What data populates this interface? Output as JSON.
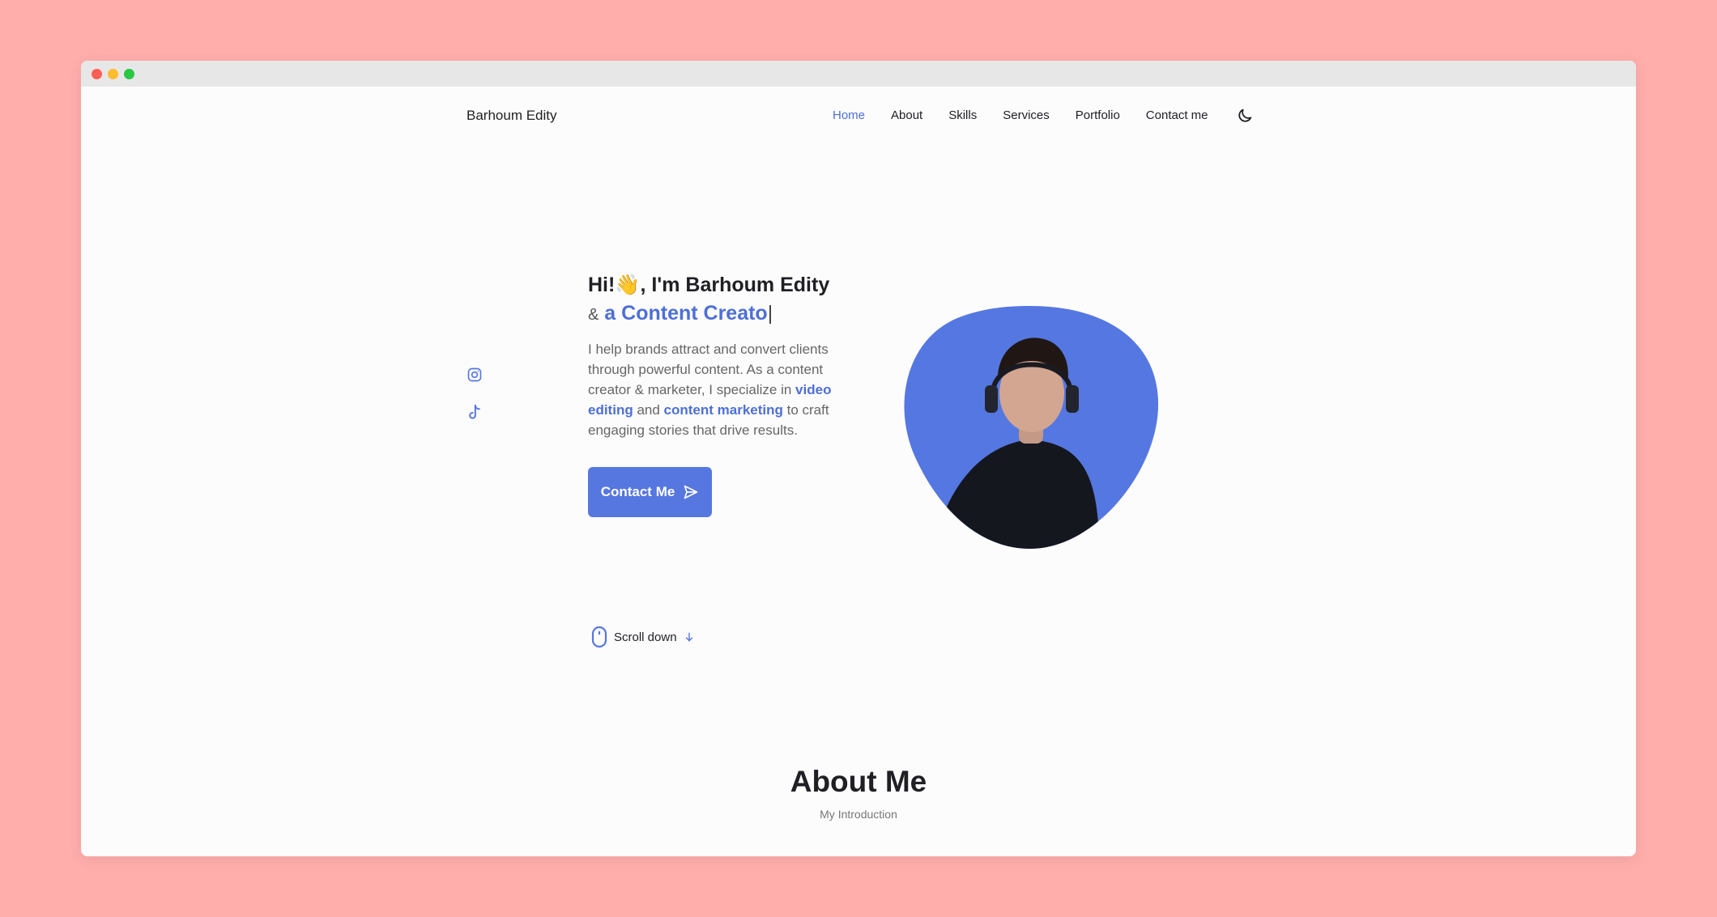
{
  "nav": {
    "logo": "Barhoum Edity",
    "links": [
      "Home",
      "About",
      "Skills",
      "Services",
      "Portfolio",
      "Contact me"
    ],
    "active": "Home",
    "theme_icon": "moon-icon"
  },
  "hero": {
    "greeting": "Hi!",
    "wave_emoji": "👋",
    "name_part": ", I'm Barhoum Edity",
    "amp": "&",
    "role": "a Content Creato",
    "cursor": "|",
    "desc_1": "I help brands attract and convert clients through powerful content. As a content creator & marketer, I specialize in ",
    "desc_hl_1": "video editing",
    "desc_2": " and ",
    "desc_hl_2": "content marketing",
    "desc_3": " to craft engaging stories that drive results.",
    "button_label": "Contact Me"
  },
  "social": [
    "instagram-icon",
    "tiktok-icon"
  ],
  "scroll": {
    "label": "Scroll down"
  },
  "about": {
    "title": "About Me",
    "subtitle": "My Introduction"
  },
  "colors": {
    "accent": "#5677e0",
    "background": "#ffaeac",
    "page": "#fcfcfd"
  }
}
